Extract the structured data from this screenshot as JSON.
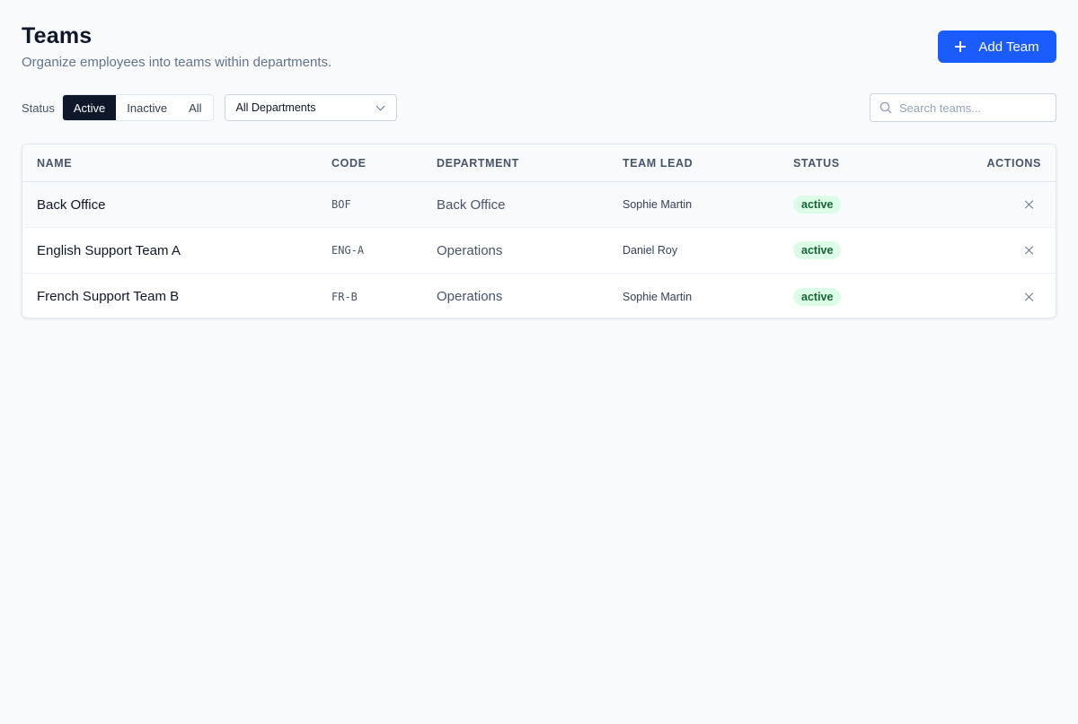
{
  "header": {
    "title": "Teams",
    "subtitle": "Organize employees into teams within departments."
  },
  "toolbar": {
    "add_label": "Add Team",
    "accent_color": "#1a5cff"
  },
  "filters": {
    "status_label": "Status",
    "status_options": [
      "Active",
      "Inactive",
      "All"
    ],
    "status_selected": "Active",
    "department_selected": "All Departments"
  },
  "search": {
    "placeholder": "Search teams...",
    "value": ""
  },
  "table": {
    "headers": {
      "name": "NAME",
      "code": "CODE",
      "department": "DEPARTMENT",
      "team_lead": "TEAM LEAD",
      "status": "STATUS",
      "actions": "ACTIONS"
    },
    "rows": [
      {
        "name": "Back Office",
        "code": "BOF",
        "department": "Back Office",
        "team_lead": "Sophie Martin",
        "status": "active"
      },
      {
        "name": "English Support Team A",
        "code": "ENG-A",
        "department": "Operations",
        "team_lead": "Daniel Roy",
        "status": "active"
      },
      {
        "name": "French Support Team B",
        "code": "FR-B",
        "department": "Operations",
        "team_lead": "Sophie Martin",
        "status": "active"
      }
    ]
  },
  "icons": {
    "add": "plus-icon",
    "dropdown": "chevron-down-icon",
    "search": "search-icon",
    "remove": "close-icon"
  },
  "colors": {
    "status_active_bg": "#dcfce7",
    "status_active_text": "#166534",
    "segment_active_bg": "#0f172a"
  }
}
